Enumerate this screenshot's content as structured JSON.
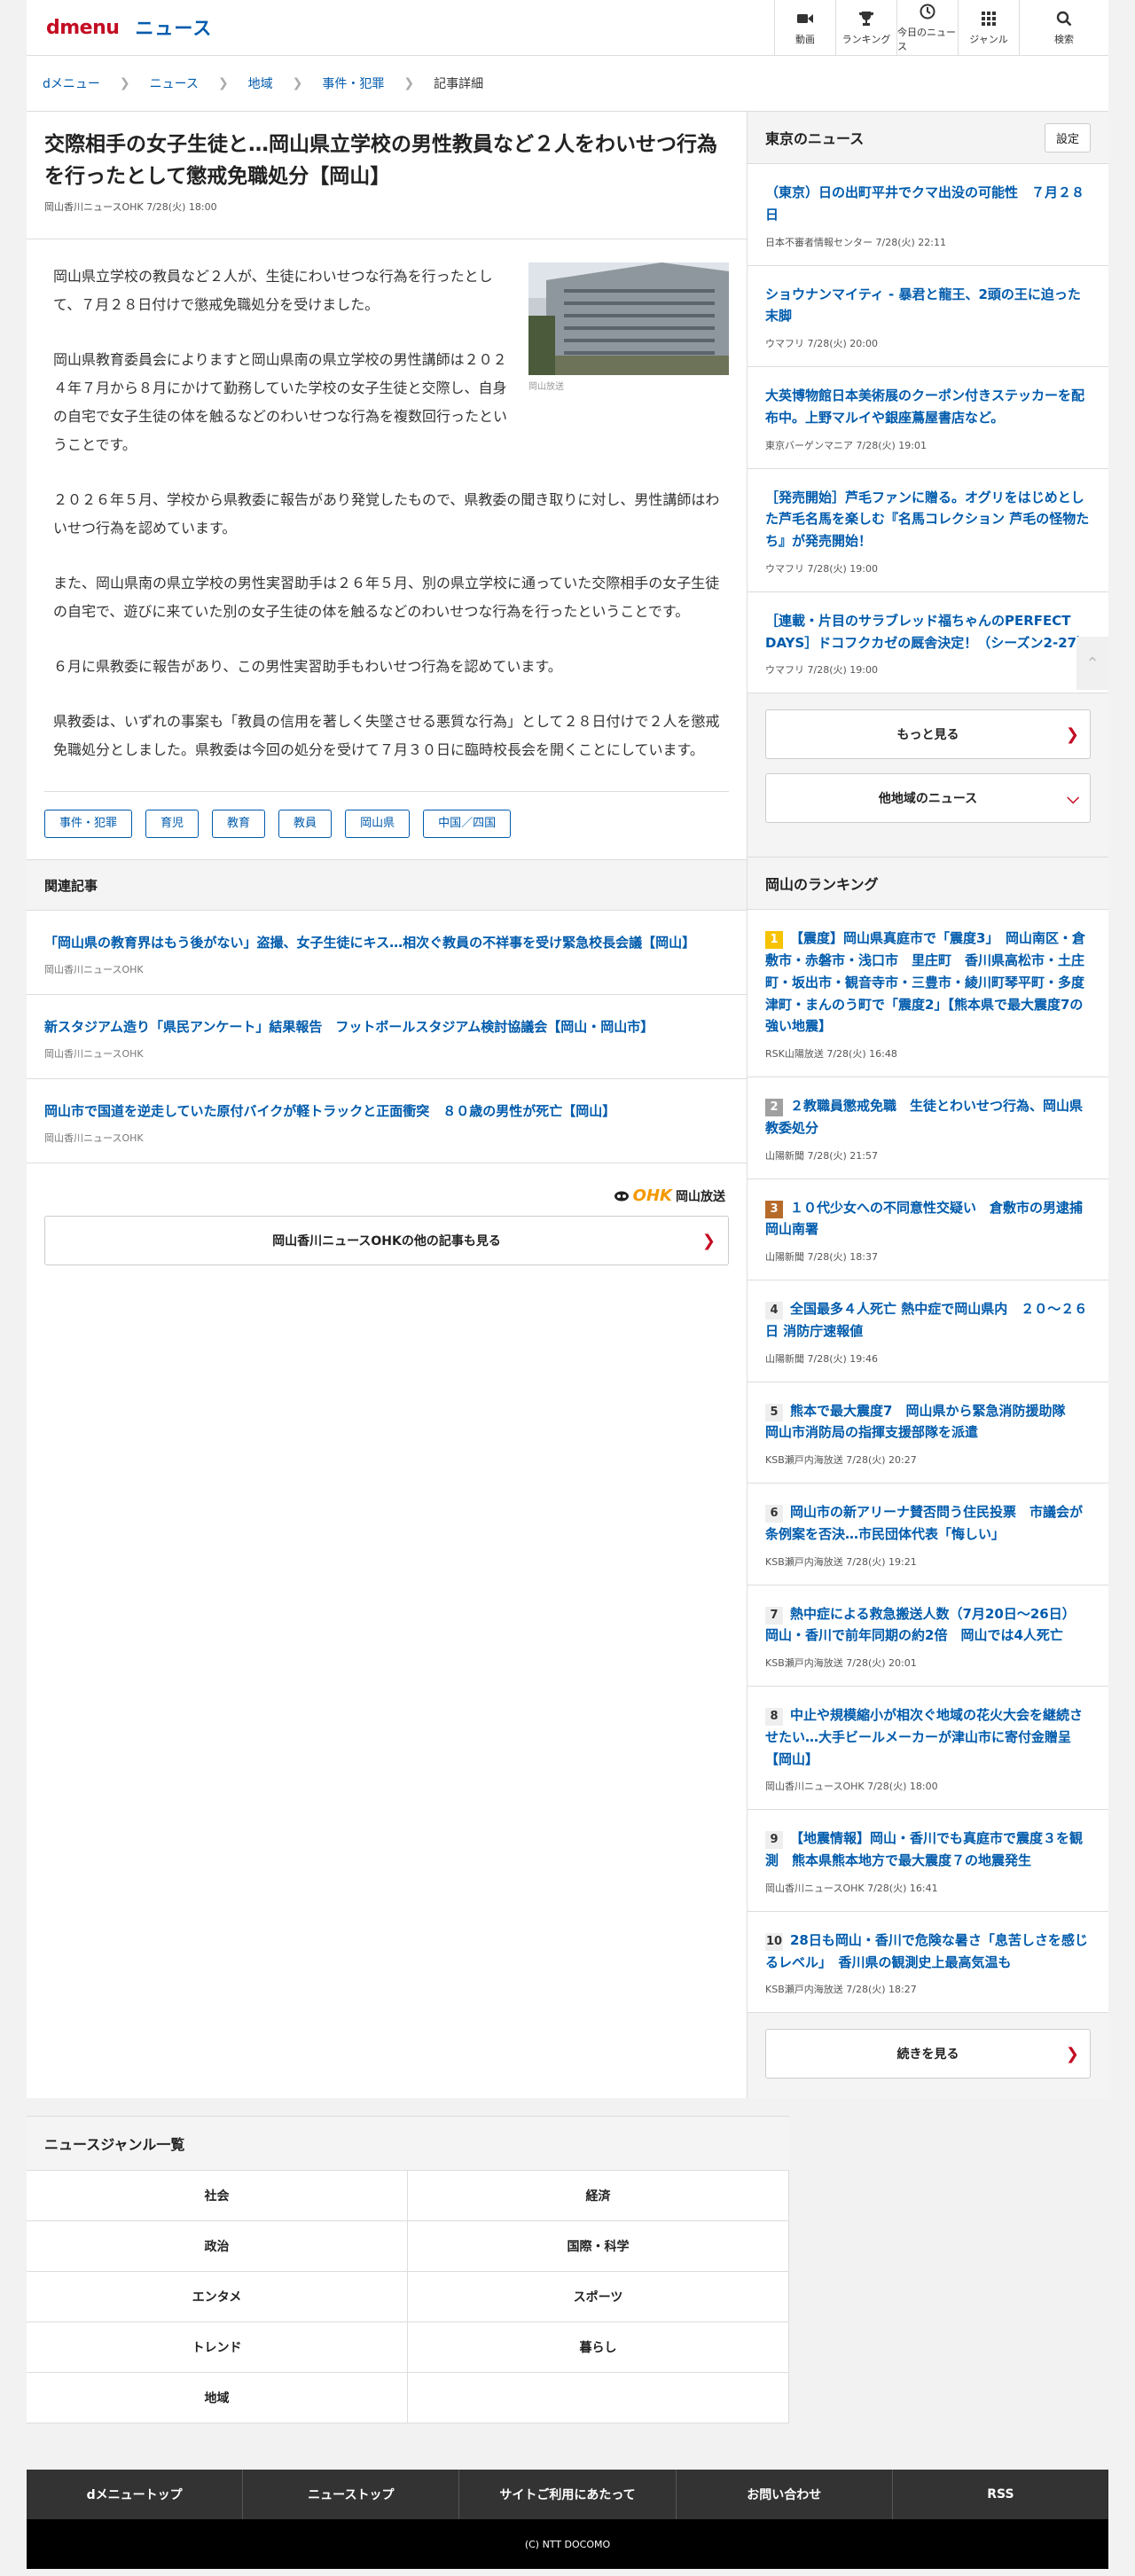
{
  "header": {
    "logo_d": "dmenu",
    "logo_news": "ニュース",
    "nav": [
      {
        "label": "動画",
        "icon": "video-icon"
      },
      {
        "label": "ランキング",
        "icon": "trophy-icon"
      },
      {
        "label": "今日のニュース",
        "icon": "clock-icon"
      },
      {
        "label": "ジャンル",
        "icon": "grid-icon"
      },
      {
        "label": "検索",
        "icon": "search-icon"
      }
    ]
  },
  "breadcrumb": [
    "dメニュー",
    "ニュース",
    "地域",
    "事件・犯罪",
    "記事詳細"
  ],
  "article": {
    "title": "交際相手の女子生徒と…岡山県立学校の男性教員など２人をわいせつ行為を行ったとして懲戒免職処分【岡山】",
    "meta": "岡山香川ニュースOHK 7/28(火) 18:00",
    "photo_caption": "岡山放送",
    "paragraphs": [
      "岡山県立学校の教員など２人が、生徒にわいせつな行為を行ったとして、７月２８日付けで懲戒免職処分を受けました。",
      "岡山県教育委員会によりますと岡山県南の県立学校の男性講師は２０２４年７月から８月にかけて勤務していた学校の女子生徒と交際し、自身の自宅で女子生徒の体を触るなどのわいせつな行為を複数回行ったということです。",
      "２０２６年５月、学校から県教委に報告があり発覚したもので、県教委の聞き取りに対し、男性講師はわいせつ行為を認めています。",
      "また、岡山県南の県立学校の男性実習助手は２６年５月、別の県立学校に通っていた交際相手の女子生徒の自宅で、遊びに来ていた別の女子生徒の体を触るなどのわいせつな行為を行ったということです。",
      "６月に県教委に報告があり、この男性実習助手もわいせつ行為を認めています。",
      "県教委は、いずれの事案も「教員の信用を著しく失墜させる悪質な行為」として２８日付けで２人を懲戒免職処分としました。県教委は今回の処分を受けて７月３０日に臨時校長会を開くことにしています。"
    ],
    "tags": [
      "事件・犯罪",
      "育児",
      "教育",
      "教員",
      "岡山県",
      "中国／四国"
    ]
  },
  "related": {
    "heading": "関連記事",
    "items": [
      {
        "title": "「岡山県の教育界はもう後がない」盗撮、女子生徒にキス…相次ぐ教員の不祥事を受け緊急校長会議【岡山】",
        "source": "岡山香川ニュースOHK"
      },
      {
        "title": "新スタジアム造り「県民アンケート」結果報告　フットボールスタジアム検討協議会【岡山・岡山市】",
        "source": "岡山香川ニュースOHK"
      },
      {
        "title": "岡山市で国道を逆走していた原付バイクが軽トラックと正面衝突　８０歳の男性が死亡【岡山】",
        "source": "岡山香川ニュースOHK"
      }
    ],
    "brand_logo": "OHK",
    "brand_name": "岡山放送",
    "more_label": "岡山香川ニュースOHKの他の記事も見る"
  },
  "tokyo": {
    "heading": "東京のニュース",
    "setting": "設定",
    "items": [
      {
        "title": "（東京）日の出町平井でクマ出没の可能性　７月２８日",
        "meta": "日本不審者情報センター 7/28(火) 22:11"
      },
      {
        "title": "ショウナンマイティ - 暴君と龍王、2頭の王に迫った末脚",
        "meta": "ウマフリ 7/28(火) 20:00"
      },
      {
        "title": "大英博物館日本美術展のクーポン付きステッカーを配布中。上野マルイや銀座蔦屋書店など。",
        "meta": "東京バーゲンマニア 7/28(火) 19:01"
      },
      {
        "title": "［発売開始］芦毛ファンに贈る。オグリをはじめとした芦毛名馬を楽しむ『名馬コレクション 芦毛の怪物たち』が発売開始！",
        "meta": "ウマフリ 7/28(火) 19:00"
      },
      {
        "title": "［連載・片目のサラブレッド福ちゃんのPERFECT DAYS］ドコフクカゼの厩舎決定！（シーズン2-27）",
        "meta": "ウマフリ 7/28(火) 19:00"
      }
    ],
    "more_label": "もっと見る",
    "other_label": "他地域のニュース"
  },
  "ranking": {
    "heading": "岡山のランキング",
    "items": [
      {
        "rank": "1",
        "title": "【震度】岡山県真庭市で「震度3」　岡山南区・倉敷市・赤磐市・浅口市　里庄町　香川県高松市・土庄町・坂出市・観音寺市・三豊市・綾川町琴平町・多度津町・まんのう町で「震度2」【熊本県で最大震度7の強い地震】",
        "meta": "RSK山陽放送 7/28(火) 16:48"
      },
      {
        "rank": "2",
        "title": "２教職員懲戒免職　生徒とわいせつ行為、岡山県教委処分",
        "meta": "山陽新聞 7/28(火) 21:57"
      },
      {
        "rank": "3",
        "title": "１０代少女への不同意性交疑い　倉敷市の男逮捕 岡山南署",
        "meta": "山陽新聞 7/28(火) 18:37"
      },
      {
        "rank": "4",
        "title": "全国最多４人死亡 熱中症で岡山県内　２０～２６日 消防庁速報値",
        "meta": "山陽新聞 7/28(火) 19:46"
      },
      {
        "rank": "5",
        "title": "熊本で最大震度7　岡山県から緊急消防援助隊　岡山市消防局の指揮支援部隊を派遣",
        "meta": "KSB瀬戸内海放送 7/28(火) 20:27"
      },
      {
        "rank": "6",
        "title": "岡山市の新アリーナ賛否問う住民投票　市議会が条例案を否決…市民団体代表「悔しい」",
        "meta": "KSB瀬戸内海放送 7/28(火) 19:21"
      },
      {
        "rank": "7",
        "title": "熱中症による救急搬送人数（7月20日～26日）　岡山・香川で前年同期の約2倍　岡山では4人死亡",
        "meta": "KSB瀬戸内海放送 7/28(火) 20:01"
      },
      {
        "rank": "8",
        "title": "中止や規模縮小が相次ぐ地域の花火大会を継続させたい…大手ビールメーカーが津山市に寄付金贈呈【岡山】",
        "meta": "岡山香川ニュースOHK 7/28(火) 18:00"
      },
      {
        "rank": "9",
        "title": "【地震情報】岡山・香川でも真庭市で震度３を観測　熊本県熊本地方で最大震度７の地震発生",
        "meta": "岡山香川ニュースOHK 7/28(火) 16:41"
      },
      {
        "rank": "10",
        "title": "28日も岡山・香川で危険な暑さ「息苦しさを感じるレベル」　香川県の観測史上最高気温も",
        "meta": "KSB瀬戸内海放送 7/28(火) 18:27"
      }
    ],
    "more_label": "続きを見る"
  },
  "genre": {
    "heading": "ニュースジャンル一覧",
    "items": [
      "社会",
      "経済",
      "政治",
      "国際・科学",
      "エンタメ",
      "スポーツ",
      "トレンド",
      "暮らし",
      "地域",
      ""
    ]
  },
  "footer": {
    "links": [
      "dメニュートップ",
      "ニューストップ",
      "サイトご利用にあたって",
      "お問い合わせ",
      "RSS"
    ],
    "copyright": "(C) NTT DOCOMO"
  },
  "colors": {
    "brand_red": "#c30d23",
    "link_blue": "#005bac",
    "ohk_orange": "#f39800"
  }
}
